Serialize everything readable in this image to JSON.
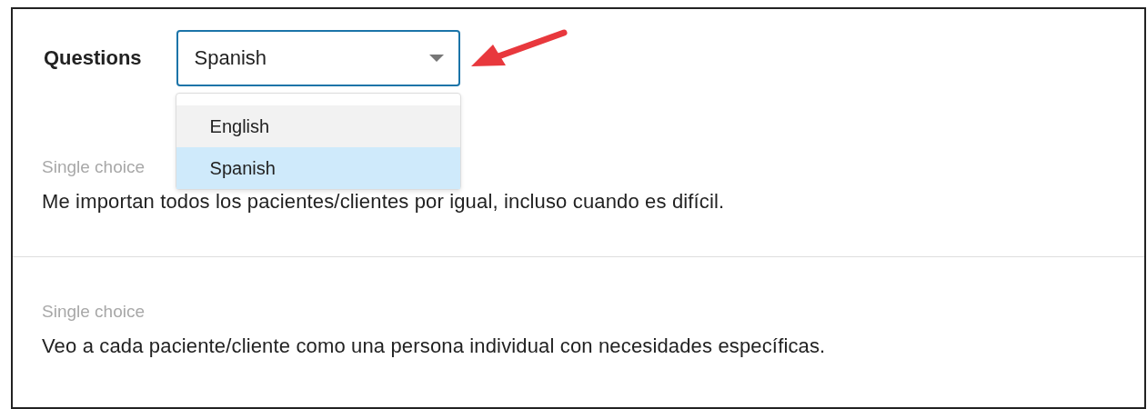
{
  "filter": {
    "label": "Questions",
    "value": "Spanish",
    "expanded": true,
    "options": [
      {
        "label": "English",
        "selected": false
      },
      {
        "label": "Spanish",
        "selected": true
      }
    ]
  },
  "questions": [
    {
      "type": "Single choice",
      "text": "Me importan todos los pacientes/clientes por igual, incluso cuando es difícil."
    },
    {
      "type": "Single choice",
      "text": "Veo a cada paciente/cliente como una persona individual con necesidades específicas."
    }
  ]
}
